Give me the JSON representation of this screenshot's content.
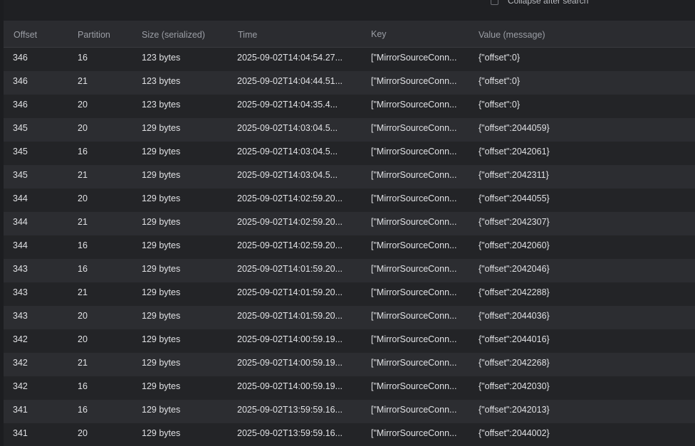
{
  "toolbar": {
    "collapse_label": "Collapse after search"
  },
  "table": {
    "columns": [
      "Offset",
      "Partition",
      "Size (serialized)",
      "Time",
      "Key",
      "Value (message)"
    ],
    "rows": [
      {
        "offset": "346",
        "partition": "16",
        "size": "123 bytes",
        "time": "2025-09-02T14:04:54.27...",
        "key": "[\"MirrorSourceConn...",
        "value": "{\"offset\":0}"
      },
      {
        "offset": "346",
        "partition": "21",
        "size": "123 bytes",
        "time": "2025-09-02T14:04:44.51...",
        "key": "[\"MirrorSourceConn...",
        "value": "{\"offset\":0}"
      },
      {
        "offset": "346",
        "partition": "20",
        "size": "123 bytes",
        "time": "2025-09-02T14:04:35.4...",
        "key": "[\"MirrorSourceConn...",
        "value": "{\"offset\":0}"
      },
      {
        "offset": "345",
        "partition": "20",
        "size": "129 bytes",
        "time": "2025-09-02T14:03:04.5...",
        "key": "[\"MirrorSourceConn...",
        "value": "{\"offset\":2044059}"
      },
      {
        "offset": "345",
        "partition": "16",
        "size": "129 bytes",
        "time": "2025-09-02T14:03:04.5...",
        "key": "[\"MirrorSourceConn...",
        "value": "{\"offset\":2042061}"
      },
      {
        "offset": "345",
        "partition": "21",
        "size": "129 bytes",
        "time": "2025-09-02T14:03:04.5...",
        "key": "[\"MirrorSourceConn...",
        "value": "{\"offset\":2042311}"
      },
      {
        "offset": "344",
        "partition": "20",
        "size": "129 bytes",
        "time": "2025-09-02T14:02:59.20...",
        "key": "[\"MirrorSourceConn...",
        "value": "{\"offset\":2044055}"
      },
      {
        "offset": "344",
        "partition": "21",
        "size": "129 bytes",
        "time": "2025-09-02T14:02:59.20...",
        "key": "[\"MirrorSourceConn...",
        "value": "{\"offset\":2042307}"
      },
      {
        "offset": "344",
        "partition": "16",
        "size": "129 bytes",
        "time": "2025-09-02T14:02:59.20...",
        "key": "[\"MirrorSourceConn...",
        "value": "{\"offset\":2042060}"
      },
      {
        "offset": "343",
        "partition": "16",
        "size": "129 bytes",
        "time": "2025-09-02T14:01:59.20...",
        "key": "[\"MirrorSourceConn...",
        "value": "{\"offset\":2042046}"
      },
      {
        "offset": "343",
        "partition": "21",
        "size": "129 bytes",
        "time": "2025-09-02T14:01:59.20...",
        "key": "[\"MirrorSourceConn...",
        "value": "{\"offset\":2042288}"
      },
      {
        "offset": "343",
        "partition": "20",
        "size": "129 bytes",
        "time": "2025-09-02T14:01:59.20...",
        "key": "[\"MirrorSourceConn...",
        "value": "{\"offset\":2044036}"
      },
      {
        "offset": "342",
        "partition": "20",
        "size": "129 bytes",
        "time": "2025-09-02T14:00:59.19...",
        "key": "[\"MirrorSourceConn...",
        "value": "{\"offset\":2044016}"
      },
      {
        "offset": "342",
        "partition": "21",
        "size": "129 bytes",
        "time": "2025-09-02T14:00:59.19...",
        "key": "[\"MirrorSourceConn...",
        "value": "{\"offset\":2042268}"
      },
      {
        "offset": "342",
        "partition": "16",
        "size": "129 bytes",
        "time": "2025-09-02T14:00:59.19...",
        "key": "[\"MirrorSourceConn...",
        "value": "{\"offset\":2042030}"
      },
      {
        "offset": "341",
        "partition": "16",
        "size": "129 bytes",
        "time": "2025-09-02T13:59:59.16...",
        "key": "[\"MirrorSourceConn...",
        "value": "{\"offset\":2042013}"
      },
      {
        "offset": "341",
        "partition": "20",
        "size": "129 bytes",
        "time": "2025-09-02T13:59:59.16...",
        "key": "[\"MirrorSourceConn...",
        "value": "{\"offset\":2044002}"
      }
    ]
  }
}
